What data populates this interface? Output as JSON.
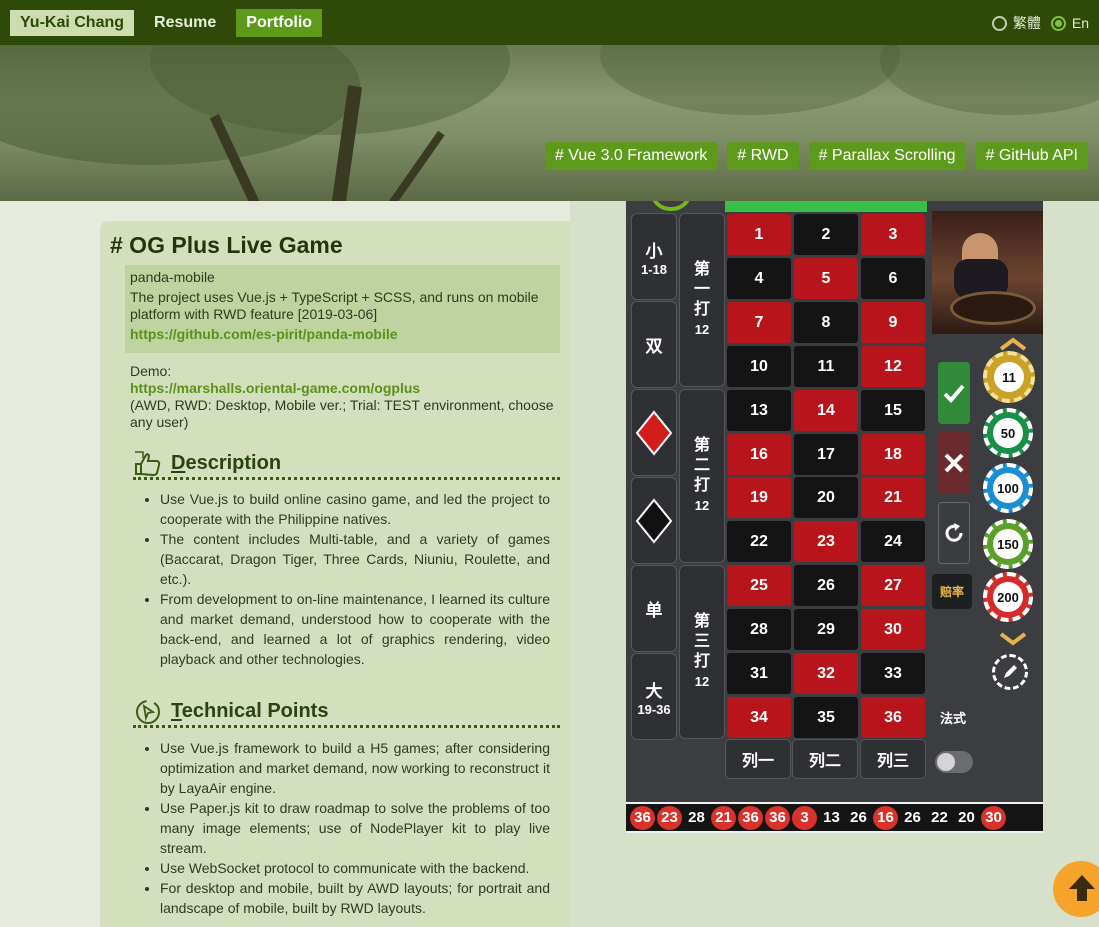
{
  "header": {
    "brand": "Yu-Kai Chang",
    "nav": [
      {
        "label": "Resume"
      },
      {
        "label": "Portfolio"
      }
    ],
    "languages": [
      {
        "label": "繁體",
        "selected": false
      },
      {
        "label": "En",
        "selected": true
      }
    ]
  },
  "hero": {
    "tags": [
      "# Vue 3.0 Framework",
      "# RWD",
      "# Parallax Scrolling",
      "# GitHub API"
    ]
  },
  "project": {
    "title": "# OG Plus Live Game",
    "repo_name": "panda-mobile",
    "repo_desc": "The project uses Vue.js + TypeScript + SCSS, and runs on mobile platform with RWD feature [2019-03-06]",
    "repo_link": "https://github.com/es-pirit/panda-mobile",
    "demo_label": "Demo:",
    "demo_link": "https://marshalls.oriental-game.com/ogplus",
    "demo_note": "(AWD, RWD: Desktop, Mobile ver.; Trial: TEST environment, choose any user)"
  },
  "description": {
    "heading_first": "D",
    "heading_rest": "escription",
    "items": [
      "Use Vue.js to build online casino game, and led the project to cooperate with the Philippine natives.",
      "The content includes Multi-table, and a variety of games (Baccarat, Dragon Tiger, Three Cards, Niuniu, Roulette, and etc.).",
      "From development to on-line maintenance, I learned its culture and market demand, understood how to cooperate with the back-end, and learned a lot of graphics rendering, video playback and other technologies."
    ]
  },
  "technical": {
    "heading_first": "T",
    "heading_rest": "echnical Points",
    "items": [
      "Use Vue.js framework to build a H5 games; after considering optimization and market demand, now working to reconstruct it by LayaAir engine.",
      "Use Paper.js kit to draw roadmap to solve the problems of too many image elements; use of NodePlayer kit to play live stream.",
      "Use WebSocket protocol to communicate with the backend.",
      "For desktop and mobile, built by AWD layouts; for portrait and landscape of mobile, built by RWD layouts."
    ]
  },
  "game": {
    "side_small": "小",
    "side_small_range": "1-18",
    "side_even": "双",
    "side_odd": "单",
    "side_big": "大",
    "side_big_range": "19-36",
    "dozen1_a": "第",
    "dozen1_b": "一",
    "dozen1_c": "打",
    "dozen1_d": "12",
    "dozen2_a": "第",
    "dozen2_b": "二",
    "dozen2_c": "打",
    "dozen2_d": "12",
    "dozen3_a": "第",
    "dozen3_b": "三",
    "dozen3_c": "打",
    "dozen3_d": "12",
    "numbers": [
      {
        "n": "1",
        "c": "red"
      },
      {
        "n": "2",
        "c": "black"
      },
      {
        "n": "3",
        "c": "red"
      },
      {
        "n": "4",
        "c": "black"
      },
      {
        "n": "5",
        "c": "red"
      },
      {
        "n": "6",
        "c": "black"
      },
      {
        "n": "7",
        "c": "red"
      },
      {
        "n": "8",
        "c": "black"
      },
      {
        "n": "9",
        "c": "red"
      },
      {
        "n": "10",
        "c": "black"
      },
      {
        "n": "11",
        "c": "black"
      },
      {
        "n": "12",
        "c": "red"
      },
      {
        "n": "13",
        "c": "black"
      },
      {
        "n": "14",
        "c": "red"
      },
      {
        "n": "15",
        "c": "black"
      },
      {
        "n": "16",
        "c": "red"
      },
      {
        "n": "17",
        "c": "black"
      },
      {
        "n": "18",
        "c": "red"
      },
      {
        "n": "19",
        "c": "red"
      },
      {
        "n": "20",
        "c": "black"
      },
      {
        "n": "21",
        "c": "red"
      },
      {
        "n": "22",
        "c": "black"
      },
      {
        "n": "23",
        "c": "red"
      },
      {
        "n": "24",
        "c": "black"
      },
      {
        "n": "25",
        "c": "red"
      },
      {
        "n": "26",
        "c": "black"
      },
      {
        "n": "27",
        "c": "red"
      },
      {
        "n": "28",
        "c": "black"
      },
      {
        "n": "29",
        "c": "black"
      },
      {
        "n": "30",
        "c": "red"
      },
      {
        "n": "31",
        "c": "black"
      },
      {
        "n": "32",
        "c": "red"
      },
      {
        "n": "33",
        "c": "black"
      },
      {
        "n": "34",
        "c": "red"
      },
      {
        "n": "35",
        "c": "black"
      },
      {
        "n": "36",
        "c": "red"
      }
    ],
    "columns": [
      "列一",
      "列二",
      "列三"
    ],
    "odds_label": "赔率",
    "french_label": "法式",
    "chips": [
      "11",
      "50",
      "100",
      "150",
      "200"
    ],
    "history": [
      {
        "n": "36",
        "red": true
      },
      {
        "n": "23",
        "red": true
      },
      {
        "n": "28",
        "red": false
      },
      {
        "n": "21",
        "red": true
      },
      {
        "n": "36",
        "red": true
      },
      {
        "n": "36",
        "red": true
      },
      {
        "n": "3",
        "red": true
      },
      {
        "n": "13",
        "red": false
      },
      {
        "n": "26",
        "red": false
      },
      {
        "n": "16",
        "red": true
      },
      {
        "n": "26",
        "red": false
      },
      {
        "n": "22",
        "red": false
      },
      {
        "n": "20",
        "red": false
      },
      {
        "n": "30",
        "red": true
      }
    ],
    "colors": {
      "red": "#b7151b",
      "black": "#141414",
      "accent": "#5d9a1b"
    }
  }
}
